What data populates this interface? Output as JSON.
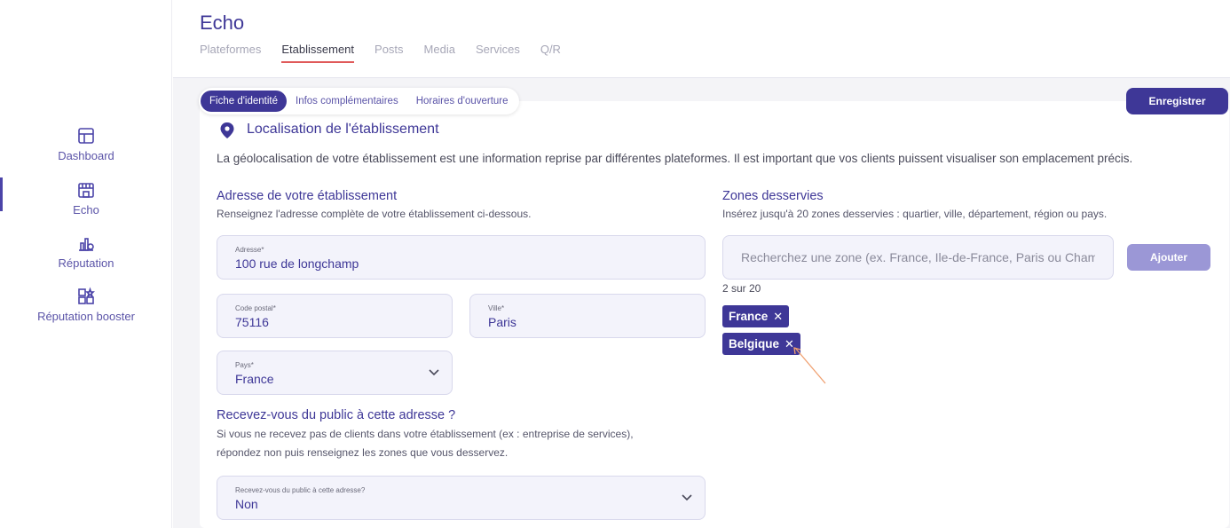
{
  "sidebar": {
    "items": [
      {
        "label": "Dashboard",
        "icon": "dashboard-icon"
      },
      {
        "label": "Echo",
        "icon": "store-icon"
      },
      {
        "label": "Réputation",
        "icon": "reputation-icon"
      },
      {
        "label": "Réputation booster",
        "icon": "reputation-booster-icon"
      }
    ]
  },
  "header": {
    "title": "Echo",
    "tabs": [
      "Plateformes",
      "Etablissement",
      "Posts",
      "Media",
      "Services",
      "Q/R"
    ]
  },
  "subtabs": [
    "Fiche d'identité",
    "Infos complémentaires",
    "Horaires d'ouverture"
  ],
  "save_label": "Enregistrer",
  "section": {
    "title": "Localisation de l'établissement",
    "description": "La géolocalisation de votre établissement est une information reprise par différentes plateformes. Il est important que vos clients puissent visualiser son emplacement précis."
  },
  "address": {
    "heading": "Adresse de votre établissement",
    "hint": "Renseignez l'adresse complète de votre établissement ci-dessous.",
    "fields": {
      "address_label": "Adresse*",
      "address_value": "100 rue de longchamp",
      "postal_label": "Code postal*",
      "postal_value": "75116",
      "city_label": "Ville*",
      "city_value": "Paris",
      "country_label": "Pays*",
      "country_value": "France"
    }
  },
  "public": {
    "heading": "Recevez-vous du public à cette adresse ?",
    "hint_line1": "Si vous ne recevez pas de clients dans votre établissement (ex : entreprise de services),",
    "hint_line2": "répondez non puis renseignez les zones que vous desservez.",
    "select_label": "Recevez-vous du public à cette adresse?",
    "select_value": "Non"
  },
  "zones": {
    "heading": "Zones desservies",
    "hint": "Insérez jusqu'à 20 zones desservies : quartier, ville, département, région ou pays.",
    "placeholder": "Recherchez une zone (ex. France, Ile-de-France, Paris ou Champs-Elysées)",
    "add_label": "Ajouter",
    "count": "2 sur 20",
    "chips": [
      "France",
      "Belgique"
    ]
  },
  "colors": {
    "primary": "#3e3797",
    "accent_underline": "#e05a5a",
    "arrow": "#f0a070"
  }
}
